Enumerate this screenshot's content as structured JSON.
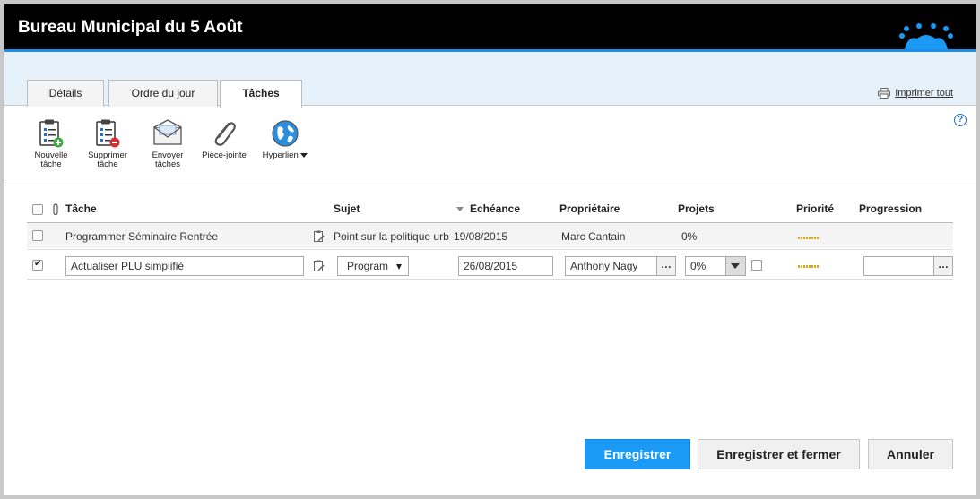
{
  "window": {
    "title": "Bureau Municipal du 5 Août"
  },
  "tabs": [
    {
      "label": "Détails"
    },
    {
      "label": "Ordre du jour"
    },
    {
      "label": "Tâches",
      "active": true
    }
  ],
  "print_all": "Imprimer tout",
  "help": "?",
  "toolbar": {
    "new_task_l1": "Nouvelle",
    "new_task_l2": "tâche",
    "delete_task_l1": "Supprimer",
    "delete_task_l2": "tâche",
    "send_tasks_l1": "Envoyer",
    "send_tasks_l2": "tâches",
    "attachment": "Pièce-jointe",
    "hyperlink": "Hyperlien"
  },
  "table": {
    "headers": {
      "task": "Tâche",
      "subject": "Sujet",
      "due": "Echéance",
      "owner": "Propriétaire",
      "projects": "Projets",
      "priority": "Priorité",
      "progress": "Progression"
    },
    "rows": [
      {
        "checked": false,
        "task": "Programmer Séminaire Rentrée",
        "subject": "Point sur la politique urbaine",
        "due": "19/08/2015",
        "owner": "Marc Cantain",
        "projects": "0%"
      },
      {
        "checked": true,
        "task": "Actualiser PLU simplifié",
        "subject": "Program",
        "due": "26/08/2015",
        "owner": "Anthony Nagy",
        "projects": "0%",
        "progress": ""
      }
    ]
  },
  "buttons": {
    "save": "Enregistrer",
    "save_close": "Enregistrer et fermer",
    "cancel": "Annuler"
  },
  "colors": {
    "accent": "#1a9af5",
    "titlebar": "#000000",
    "tabband": "#e6f1fa",
    "priority": "#d8a91c"
  }
}
